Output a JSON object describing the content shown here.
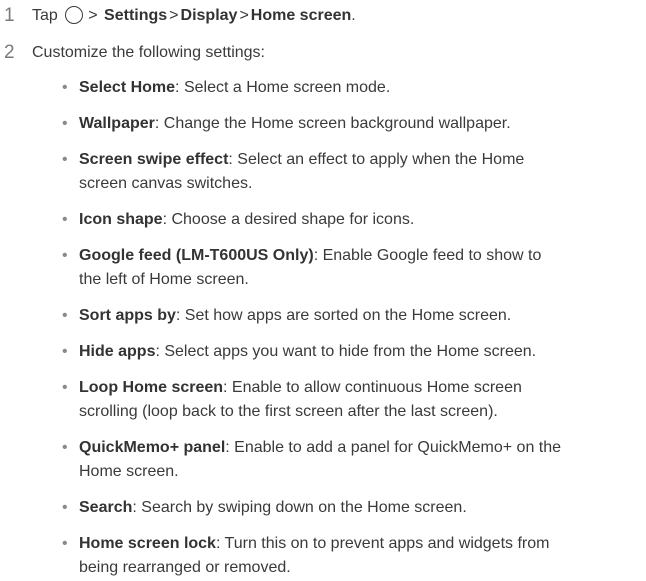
{
  "step1": {
    "number": "1",
    "tap_prefix": "Tap",
    "sep1": ">",
    "settings": "Settings",
    "sep2": ">",
    "display": "Display",
    "sep3": ">",
    "home_screen": "Home screen",
    "end": "."
  },
  "step2": {
    "number": "2",
    "text": "Customize the following settings:"
  },
  "bullets": [
    {
      "term": "Select Home",
      "desc": ": Select a Home screen mode."
    },
    {
      "term": "Wallpaper",
      "desc": ": Change the Home screen background wallpaper."
    },
    {
      "term": "Screen swipe effect",
      "desc": ": Select an effect to apply when the Home",
      "desc2": "screen canvas switches."
    },
    {
      "term": "Icon shape",
      "desc": ": Choose a desired shape for icons."
    },
    {
      "term": "Google feed (LM-T600US Only)",
      "desc": ": Enable Google feed to show to",
      "desc2": "the left of Home screen."
    },
    {
      "term": "Sort apps by",
      "desc": ": Set how apps are sorted on the Home screen."
    },
    {
      "term": "Hide apps",
      "desc": ": Select apps you want to hide from the Home screen."
    },
    {
      "term": "Loop Home screen",
      "desc": ": Enable to allow continuous Home screen",
      "desc2": "scrolling (loop back to the first screen after the last screen)."
    },
    {
      "term": "QuickMemo+ panel",
      "desc": ": Enable to add a panel for QuickMemo+ on the",
      "desc2": "Home screen."
    },
    {
      "term": "Search",
      "desc": ": Search by swiping down on the Home screen."
    },
    {
      "term": "Home screen lock",
      "desc": ": Turn this on to prevent apps and widgets from",
      "desc2": "being rearranged or removed."
    }
  ]
}
